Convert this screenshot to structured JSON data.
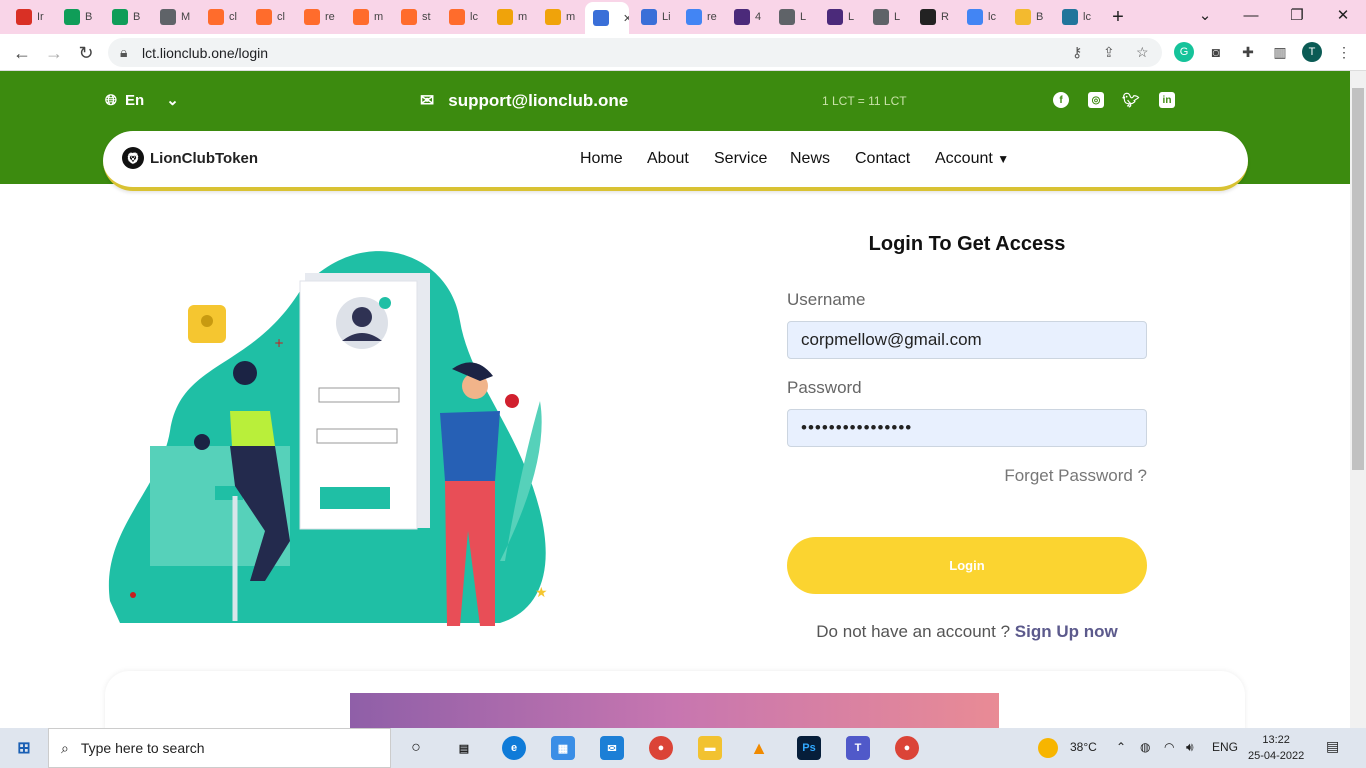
{
  "browser": {
    "tabs": [
      {
        "label": "Ir",
        "icon": "gmail-icon",
        "color": "#d93025"
      },
      {
        "label": "B",
        "icon": "sheets-icon",
        "color": "#0f9d58"
      },
      {
        "label": "B",
        "icon": "sheets-icon",
        "color": "#0f9d58"
      },
      {
        "label": "M",
        "icon": "globe-icon",
        "color": "#5f6368"
      },
      {
        "label": "cl",
        "icon": "cpanel-icon",
        "color": "#ff6c2c"
      },
      {
        "label": "cl",
        "icon": "cpanel-icon",
        "color": "#ff6c2c"
      },
      {
        "label": "re",
        "icon": "cpanel-icon",
        "color": "#ff6c2c"
      },
      {
        "label": "m",
        "icon": "cpanel-icon",
        "color": "#ff6c2c"
      },
      {
        "label": "st",
        "icon": "cpanel-icon",
        "color": "#ff6c2c"
      },
      {
        "label": "lc",
        "icon": "cpanel-icon",
        "color": "#ff6c2c"
      },
      {
        "label": "m",
        "icon": "phpmyadmin-icon",
        "color": "#f0a30a"
      },
      {
        "label": "m",
        "icon": "phpmyadmin-icon",
        "color": "#f0a30a"
      },
      {
        "label": "",
        "icon": "site-icon",
        "color": "#3a6fd8"
      },
      {
        "label": "Li",
        "icon": "site-icon",
        "color": "#3a6fd8"
      },
      {
        "label": "re",
        "icon": "google-icon",
        "color": "#4285f4"
      },
      {
        "label": "4",
        "icon": "coinlib-icon",
        "color": "#4b2a7a"
      },
      {
        "label": "L",
        "icon": "globe-icon",
        "color": "#5f6368"
      },
      {
        "label": "L",
        "icon": "coinlib-icon",
        "color": "#4b2a7a"
      },
      {
        "label": "L",
        "icon": "globe-icon",
        "color": "#5f6368"
      },
      {
        "label": "R",
        "icon": "crypto-icon",
        "color": "#222222"
      },
      {
        "label": "lc",
        "icon": "google-icon",
        "color": "#4285f4"
      },
      {
        "label": "B",
        "icon": "bnb-icon",
        "color": "#f3ba2f"
      },
      {
        "label": "lc",
        "icon": "wordpress-icon",
        "color": "#21759b"
      }
    ],
    "url": "lct.lionclub.one/login"
  },
  "site": {
    "language": "En",
    "email": "support@lionclub.one",
    "rate": "1 LCT = 11 LCT",
    "social": [
      "facebook-icon",
      "instagram-icon",
      "twitter-icon",
      "linkedin-icon"
    ],
    "logo": "LionClubToken",
    "menu": [
      "Home",
      "About",
      "Service",
      "News",
      "Contact",
      "Account"
    ],
    "brand_green": "#3c8b0f",
    "accent_yellow": "#fbd430"
  },
  "login": {
    "title": "Login To Get Access",
    "username_label": "Username",
    "username_value": "corpmellow@gmail.com",
    "password_label": "Password",
    "password_value": "••••••••••••••••",
    "forgot": "Forget Password ?",
    "button": "Login",
    "signup_prompt": "Do not have an account ?",
    "signup_link": "Sign Up now"
  },
  "taskbar": {
    "search_placeholder": "Type here to search",
    "weather": "38°C",
    "language": "ENG",
    "time": "13:22",
    "date": "25-04-2022"
  }
}
